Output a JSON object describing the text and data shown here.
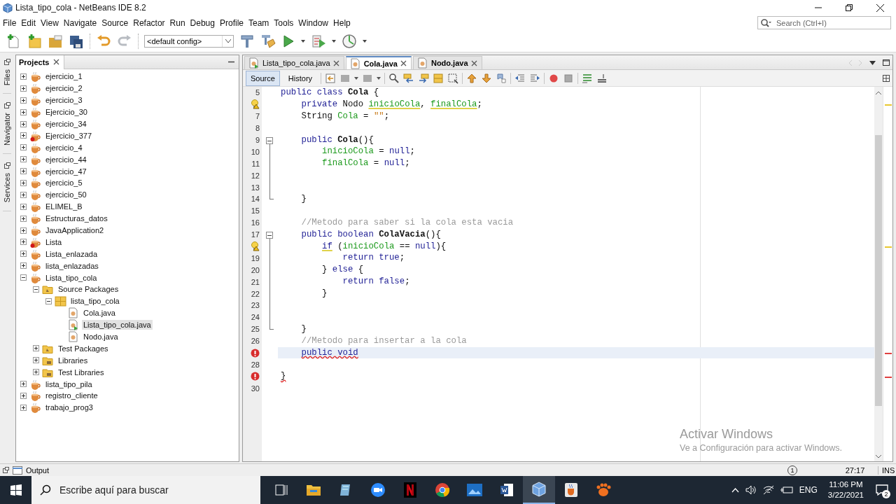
{
  "window": {
    "title": "Lista_tipo_cola - NetBeans IDE 8.2"
  },
  "menu": [
    "File",
    "Edit",
    "View",
    "Navigate",
    "Source",
    "Refactor",
    "Run",
    "Debug",
    "Profile",
    "Team",
    "Tools",
    "Window",
    "Help"
  ],
  "search": {
    "placeholder": "Search (Ctrl+I)"
  },
  "toolbar": {
    "config": "<default config>"
  },
  "side_tabs": [
    {
      "label": "Files"
    },
    {
      "label": "Navigator"
    },
    {
      "label": "Services"
    }
  ],
  "projects": {
    "title": "Projects",
    "tree": [
      {
        "label": "ejercicio_1",
        "kind": "project",
        "expanded": false,
        "selected": false
      },
      {
        "label": "ejercicio_2",
        "kind": "project",
        "expanded": false,
        "selected": false
      },
      {
        "label": "ejercicio_3",
        "kind": "project",
        "expanded": false,
        "selected": false
      },
      {
        "label": "Ejercicio_30",
        "kind": "project",
        "expanded": false,
        "selected": false
      },
      {
        "label": "ejercicio_34",
        "kind": "project",
        "expanded": false,
        "selected": false
      },
      {
        "label": "Ejercicio_377",
        "kind": "broken",
        "expanded": false,
        "selected": false
      },
      {
        "label": "ejercicio_4",
        "kind": "project",
        "expanded": false,
        "selected": false
      },
      {
        "label": "ejercicio_44",
        "kind": "project",
        "expanded": false,
        "selected": false
      },
      {
        "label": "ejercicio_47",
        "kind": "project",
        "expanded": false,
        "selected": false
      },
      {
        "label": "ejercicio_5",
        "kind": "project",
        "expanded": false,
        "selected": false
      },
      {
        "label": "ejercicio_50",
        "kind": "project",
        "expanded": false,
        "selected": false
      },
      {
        "label": "ELIMEL_B",
        "kind": "project",
        "expanded": false,
        "selected": false
      },
      {
        "label": "Estructuras_datos",
        "kind": "project",
        "expanded": false,
        "selected": false
      },
      {
        "label": "JavaApplication2",
        "kind": "project",
        "expanded": false,
        "selected": false
      },
      {
        "label": "Lista",
        "kind": "broken",
        "expanded": false,
        "selected": false
      },
      {
        "label": "Lista_enlazada",
        "kind": "project",
        "expanded": false,
        "selected": false
      },
      {
        "label": "lista_enlazadas",
        "kind": "project",
        "expanded": false,
        "selected": false
      },
      {
        "label": "Lista_tipo_cola",
        "kind": "project",
        "expanded": true,
        "selected": false,
        "children": [
          {
            "label": "Source Packages",
            "kind": "folder",
            "expanded": true,
            "selected": false,
            "children": [
              {
                "label": "lista_tipo_cola",
                "kind": "package",
                "expanded": true,
                "selected": false,
                "children": [
                  {
                    "label": "Cola.java",
                    "kind": "file",
                    "selected": false
                  },
                  {
                    "label": "Lista_tipo_cola.java",
                    "kind": "mainfile",
                    "selected": true
                  },
                  {
                    "label": "Nodo.java",
                    "kind": "file",
                    "selected": false
                  }
                ]
              }
            ]
          },
          {
            "label": "Test Packages",
            "kind": "folder",
            "expanded": false,
            "selected": false
          },
          {
            "label": "Libraries",
            "kind": "library",
            "expanded": false,
            "selected": false
          },
          {
            "label": "Test Libraries",
            "kind": "library",
            "expanded": false,
            "selected": false
          }
        ]
      },
      {
        "label": "lista_tipo_pila",
        "kind": "project",
        "expanded": false,
        "selected": false
      },
      {
        "label": "registro_cliente",
        "kind": "project",
        "expanded": false,
        "selected": false
      },
      {
        "label": "trabajo_prog3",
        "kind": "project",
        "expanded": false,
        "selected": false
      }
    ]
  },
  "editor": {
    "tabs": [
      {
        "label": "Lista_tipo_cola.java",
        "kind": "mainfile",
        "selected": false,
        "modified": false
      },
      {
        "label": "Cola.java",
        "kind": "file",
        "selected": true,
        "modified": true
      },
      {
        "label": "Nodo.java",
        "kind": "file",
        "selected": false,
        "modified": true
      }
    ],
    "view_modes": [
      {
        "label": "Source",
        "selected": true
      },
      {
        "label": "History",
        "selected": false
      }
    ],
    "lines": [
      {
        "number": "5",
        "kind": "numbered",
        "current": false,
        "tokens": [
          {
            "kind": "keyword",
            "text": "public class ",
            "underlined": false
          },
          {
            "kind": "declaration",
            "text": "Cola",
            "underlined": false
          },
          {
            "kind": "plain",
            "text": " {",
            "underlined": false
          }
        ]
      },
      {
        "kind": "hint",
        "current": false,
        "tokens": [
          {
            "kind": "keyword",
            "text": "    private",
            "underlined": false
          },
          {
            "kind": "plain",
            "text": " Nodo ",
            "underlined": false
          },
          {
            "kind": "field",
            "text": "inicioCola",
            "underlined": true
          },
          {
            "kind": "plain",
            "text": ", ",
            "underlined": false
          },
          {
            "kind": "field",
            "text": "finalCola",
            "underlined": true
          },
          {
            "kind": "plain",
            "text": ";",
            "underlined": false
          }
        ]
      },
      {
        "number": "7",
        "kind": "numbered",
        "current": false,
        "tokens": [
          {
            "kind": "plain",
            "text": "    String ",
            "underlined": false
          },
          {
            "kind": "field",
            "text": "Cola",
            "underlined": false
          },
          {
            "kind": "plain",
            "text": " = ",
            "underlined": false
          },
          {
            "kind": "string",
            "text": "\"\"",
            "underlined": false
          },
          {
            "kind": "plain",
            "text": ";",
            "underlined": false
          }
        ]
      },
      {
        "number": "8",
        "kind": "numbered",
        "current": false
      },
      {
        "number": "9",
        "kind": "numbered",
        "expanded": true,
        "current": false,
        "tokens": [
          {
            "kind": "keyword",
            "text": "    public ",
            "underlined": false
          },
          {
            "kind": "declaration",
            "text": "Cola",
            "underlined": false
          },
          {
            "kind": "plain",
            "text": "(){",
            "underlined": false
          }
        ],
        "children": [
          {
            "number": "10",
            "kind": "numbered",
            "current": false,
            "tokens": [
              {
                "kind": "field",
                "text": "        inicioCola",
                "underlined": false
              },
              {
                "kind": "plain",
                "text": " = ",
                "underlined": false
              },
              {
                "kind": "keyword",
                "text": "null",
                "underlined": false
              },
              {
                "kind": "plain",
                "text": ";",
                "underlined": false
              }
            ]
          },
          {
            "number": "11",
            "kind": "numbered",
            "current": false,
            "tokens": [
              {
                "kind": "field",
                "text": "        finalCola",
                "underlined": false
              },
              {
                "kind": "plain",
                "text": " = ",
                "underlined": false
              },
              {
                "kind": "keyword",
                "text": "null",
                "underlined": false
              },
              {
                "kind": "plain",
                "text": ";",
                "underlined": false
              }
            ]
          },
          {
            "number": "12",
            "kind": "numbered",
            "current": false
          },
          {
            "number": "13",
            "kind": "numbered",
            "current": false
          },
          {
            "number": "14",
            "kind": "numbered",
            "current": false,
            "tokens": [
              {
                "kind": "plain",
                "text": "    }",
                "underlined": false
              }
            ]
          }
        ]
      },
      {
        "number": "15",
        "kind": "numbered",
        "current": false
      },
      {
        "number": "16",
        "kind": "numbered",
        "current": false,
        "tokens": [
          {
            "kind": "comment",
            "text": "    //Metodo para saber si la cola esta vacia",
            "underlined": false
          }
        ]
      },
      {
        "number": "17",
        "kind": "numbered",
        "expanded": true,
        "current": false,
        "tokens": [
          {
            "kind": "keyword",
            "text": "    public boolean ",
            "underlined": false
          },
          {
            "kind": "declaration",
            "text": "ColaVacia",
            "underlined": false
          },
          {
            "kind": "plain",
            "text": "(){",
            "underlined": false
          }
        ],
        "children": [
          {
            "kind": "hint",
            "current": false,
            "tokens": [
              {
                "kind": "keyword",
                "text": "        if",
                "underlined": true
              },
              {
                "kind": "plain",
                "text": " (",
                "underlined": false
              },
              {
                "kind": "field",
                "text": "inicioCola",
                "underlined": false
              },
              {
                "kind": "plain",
                "text": " == ",
                "underlined": false
              },
              {
                "kind": "keyword",
                "text": "null",
                "underlined": false
              },
              {
                "kind": "plain",
                "text": "){",
                "underlined": false
              }
            ]
          },
          {
            "number": "19",
            "kind": "numbered",
            "current": false,
            "tokens": [
              {
                "kind": "keyword",
                "text": "            return true",
                "underlined": false
              },
              {
                "kind": "plain",
                "text": ";",
                "underlined": false
              }
            ]
          },
          {
            "number": "20",
            "kind": "numbered",
            "current": false,
            "tokens": [
              {
                "kind": "plain",
                "text": "        } ",
                "underlined": false
              },
              {
                "kind": "keyword",
                "text": "else",
                "underlined": false
              },
              {
                "kind": "plain",
                "text": " {",
                "underlined": false
              }
            ]
          },
          {
            "number": "21",
            "kind": "numbered",
            "current": false,
            "tokens": [
              {
                "kind": "keyword",
                "text": "            return false",
                "underlined": false
              },
              {
                "kind": "plain",
                "text": ";",
                "underlined": false
              }
            ]
          },
          {
            "number": "22",
            "kind": "numbered",
            "current": false,
            "tokens": [
              {
                "kind": "plain",
                "text": "        }",
                "underlined": false
              }
            ]
          },
          {
            "number": "23",
            "kind": "numbered",
            "current": false
          },
          {
            "number": "24",
            "kind": "numbered",
            "current": false
          },
          {
            "number": "25",
            "kind": "numbered",
            "current": false,
            "tokens": [
              {
                "kind": "plain",
                "text": "    }",
                "underlined": false
              }
            ]
          }
        ]
      },
      {
        "number": "26",
        "kind": "numbered",
        "current": false,
        "tokens": [
          {
            "kind": "comment",
            "text": "    //Metodo para insertar a la cola",
            "underlined": false
          }
        ]
      },
      {
        "kind": "error",
        "current": true,
        "tokens": [
          {
            "kind": "keyword",
            "text": "    public void",
            "underlined": true
          }
        ]
      },
      {
        "number": "28",
        "kind": "numbered",
        "current": false
      },
      {
        "kind": "error",
        "current": false,
        "tokens": [
          {
            "kind": "plain",
            "text": "}",
            "underlined": true
          }
        ]
      },
      {
        "number": "30",
        "kind": "numbered",
        "current": false
      }
    ]
  },
  "status_bar": {
    "output": "Output",
    "notifications": "1",
    "position": "27:17",
    "mode": "INS"
  },
  "activation_notice": {
    "title": "Activar Windows",
    "text": "Ve a Configuración para activar Windows."
  },
  "taskbar": {
    "search_placeholder": "Escribe aquí para buscar",
    "apps": [
      {
        "kind": "task_view",
        "active": false
      },
      {
        "kind": "folder",
        "active": false
      },
      {
        "kind": "notes",
        "active": false
      },
      {
        "kind": "camera",
        "active": false
      },
      {
        "kind": "ribbon",
        "active": false
      },
      {
        "kind": "browser",
        "active": false
      },
      {
        "kind": "photo",
        "active": false
      },
      {
        "kind": "document",
        "active": false
      },
      {
        "kind": "cube",
        "active": true
      },
      {
        "kind": "coffee",
        "active": false
      },
      {
        "kind": "paw",
        "active": false
      }
    ],
    "language": "ENG",
    "time": "11:06 PM",
    "date": "3/22/2021",
    "notification_count": "2"
  }
}
